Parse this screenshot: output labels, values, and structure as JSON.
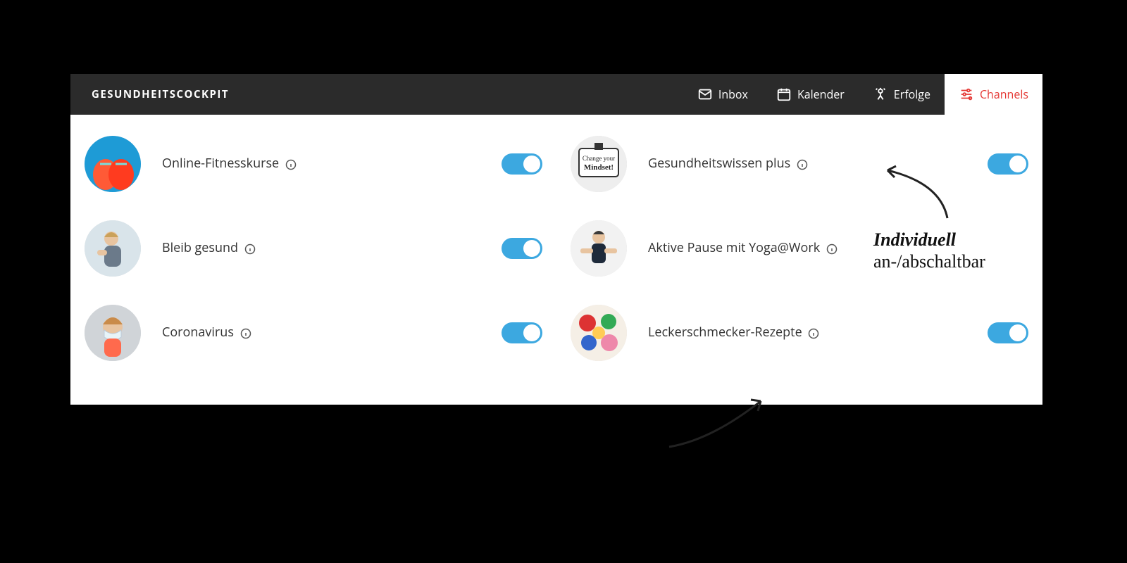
{
  "header": {
    "brand": "GESUNDHEITSCOCKPIT",
    "nav": [
      {
        "label": "Inbox",
        "icon": "mail-icon"
      },
      {
        "label": "Kalender",
        "icon": "calendar-icon"
      },
      {
        "label": "Erfolge",
        "icon": "trophy-icon"
      },
      {
        "label": "Channels",
        "icon": "sliders-icon",
        "active": true
      }
    ]
  },
  "channels": [
    {
      "label": "Online-Fitnesskurse",
      "toggle": true,
      "avatar": "shoes"
    },
    {
      "label": "Gesundheitswissen plus",
      "toggle": true,
      "avatar": "mindset"
    },
    {
      "label": "Bleib gesund",
      "toggle": true,
      "avatar": "fitness"
    },
    {
      "label": "Aktive Pause mit Yoga@Work",
      "toggle": null,
      "avatar": "yoga"
    },
    {
      "label": "Coronavirus",
      "toggle": true,
      "avatar": "mask"
    },
    {
      "label": "Leckerschmecker-Rezepte",
      "toggle": true,
      "avatar": "food"
    }
  ],
  "annotation": {
    "line1": "Individuell",
    "line2": "an-/abschaltbar"
  },
  "colors": {
    "accent": "#e53935",
    "toggle_on": "#3ca8e0",
    "header_bg": "#2b2b2b"
  }
}
